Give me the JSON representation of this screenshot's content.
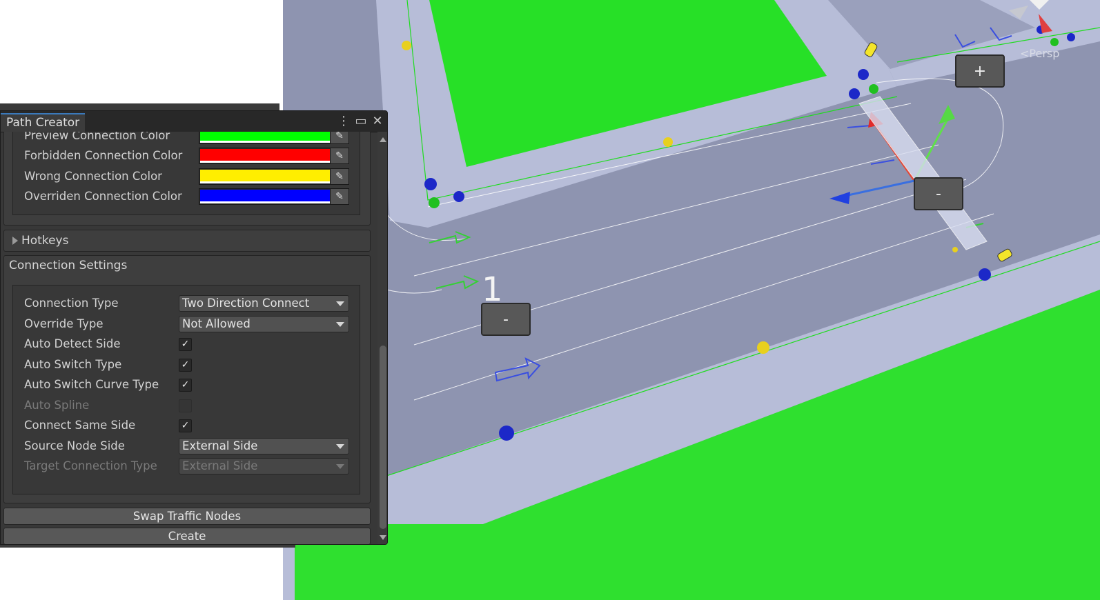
{
  "window": {
    "tab_title": "Path Creator",
    "menu_icon": "kebab-menu-icon",
    "maximize_icon": "maximize-icon",
    "close_icon": "close-icon"
  },
  "colors_section": {
    "rows": [
      {
        "label": "Preview Connection Color",
        "color": "#00ff00"
      },
      {
        "label": "Forbidden Connection Color",
        "color": "#ff0000"
      },
      {
        "label": "Wrong Connection Color",
        "color": "#ffee00"
      },
      {
        "label": "Overriden Connection Color",
        "color": "#0000ff"
      }
    ],
    "picker_icon": "eyedropper-icon"
  },
  "hotkeys": {
    "label": "Hotkeys"
  },
  "connection_settings": {
    "header": "Connection Settings",
    "connection_type": {
      "label": "Connection Type",
      "value": "Two Direction Connect"
    },
    "override_type": {
      "label": "Override Type",
      "value": "Not Allowed"
    },
    "auto_detect_side": {
      "label": "Auto Detect Side",
      "checked": true
    },
    "auto_switch_type": {
      "label": "Auto Switch Type",
      "checked": true
    },
    "auto_switch_curve_type": {
      "label": "Auto Switch Curve Type",
      "checked": true
    },
    "auto_spline": {
      "label": "Auto Spline",
      "checked": false,
      "disabled": true
    },
    "connect_same_side": {
      "label": "Connect Same Side",
      "checked": true
    },
    "source_node_side": {
      "label": "Source Node Side",
      "value": "External Side"
    },
    "target_connection_type": {
      "label": "Target Connection Type",
      "value": "External Side",
      "disabled": true
    }
  },
  "buttons": {
    "swap": "Swap Traffic Nodes",
    "create": "Create"
  },
  "scene": {
    "plus_label": "+",
    "minus_label": "-",
    "persp_label": "<Persp",
    "lane_number": "1",
    "colors": {
      "grass": "#2ee52e",
      "road": "#8e94b0",
      "sidewalk": "#b7bdd8",
      "line": "#22cc22"
    }
  }
}
